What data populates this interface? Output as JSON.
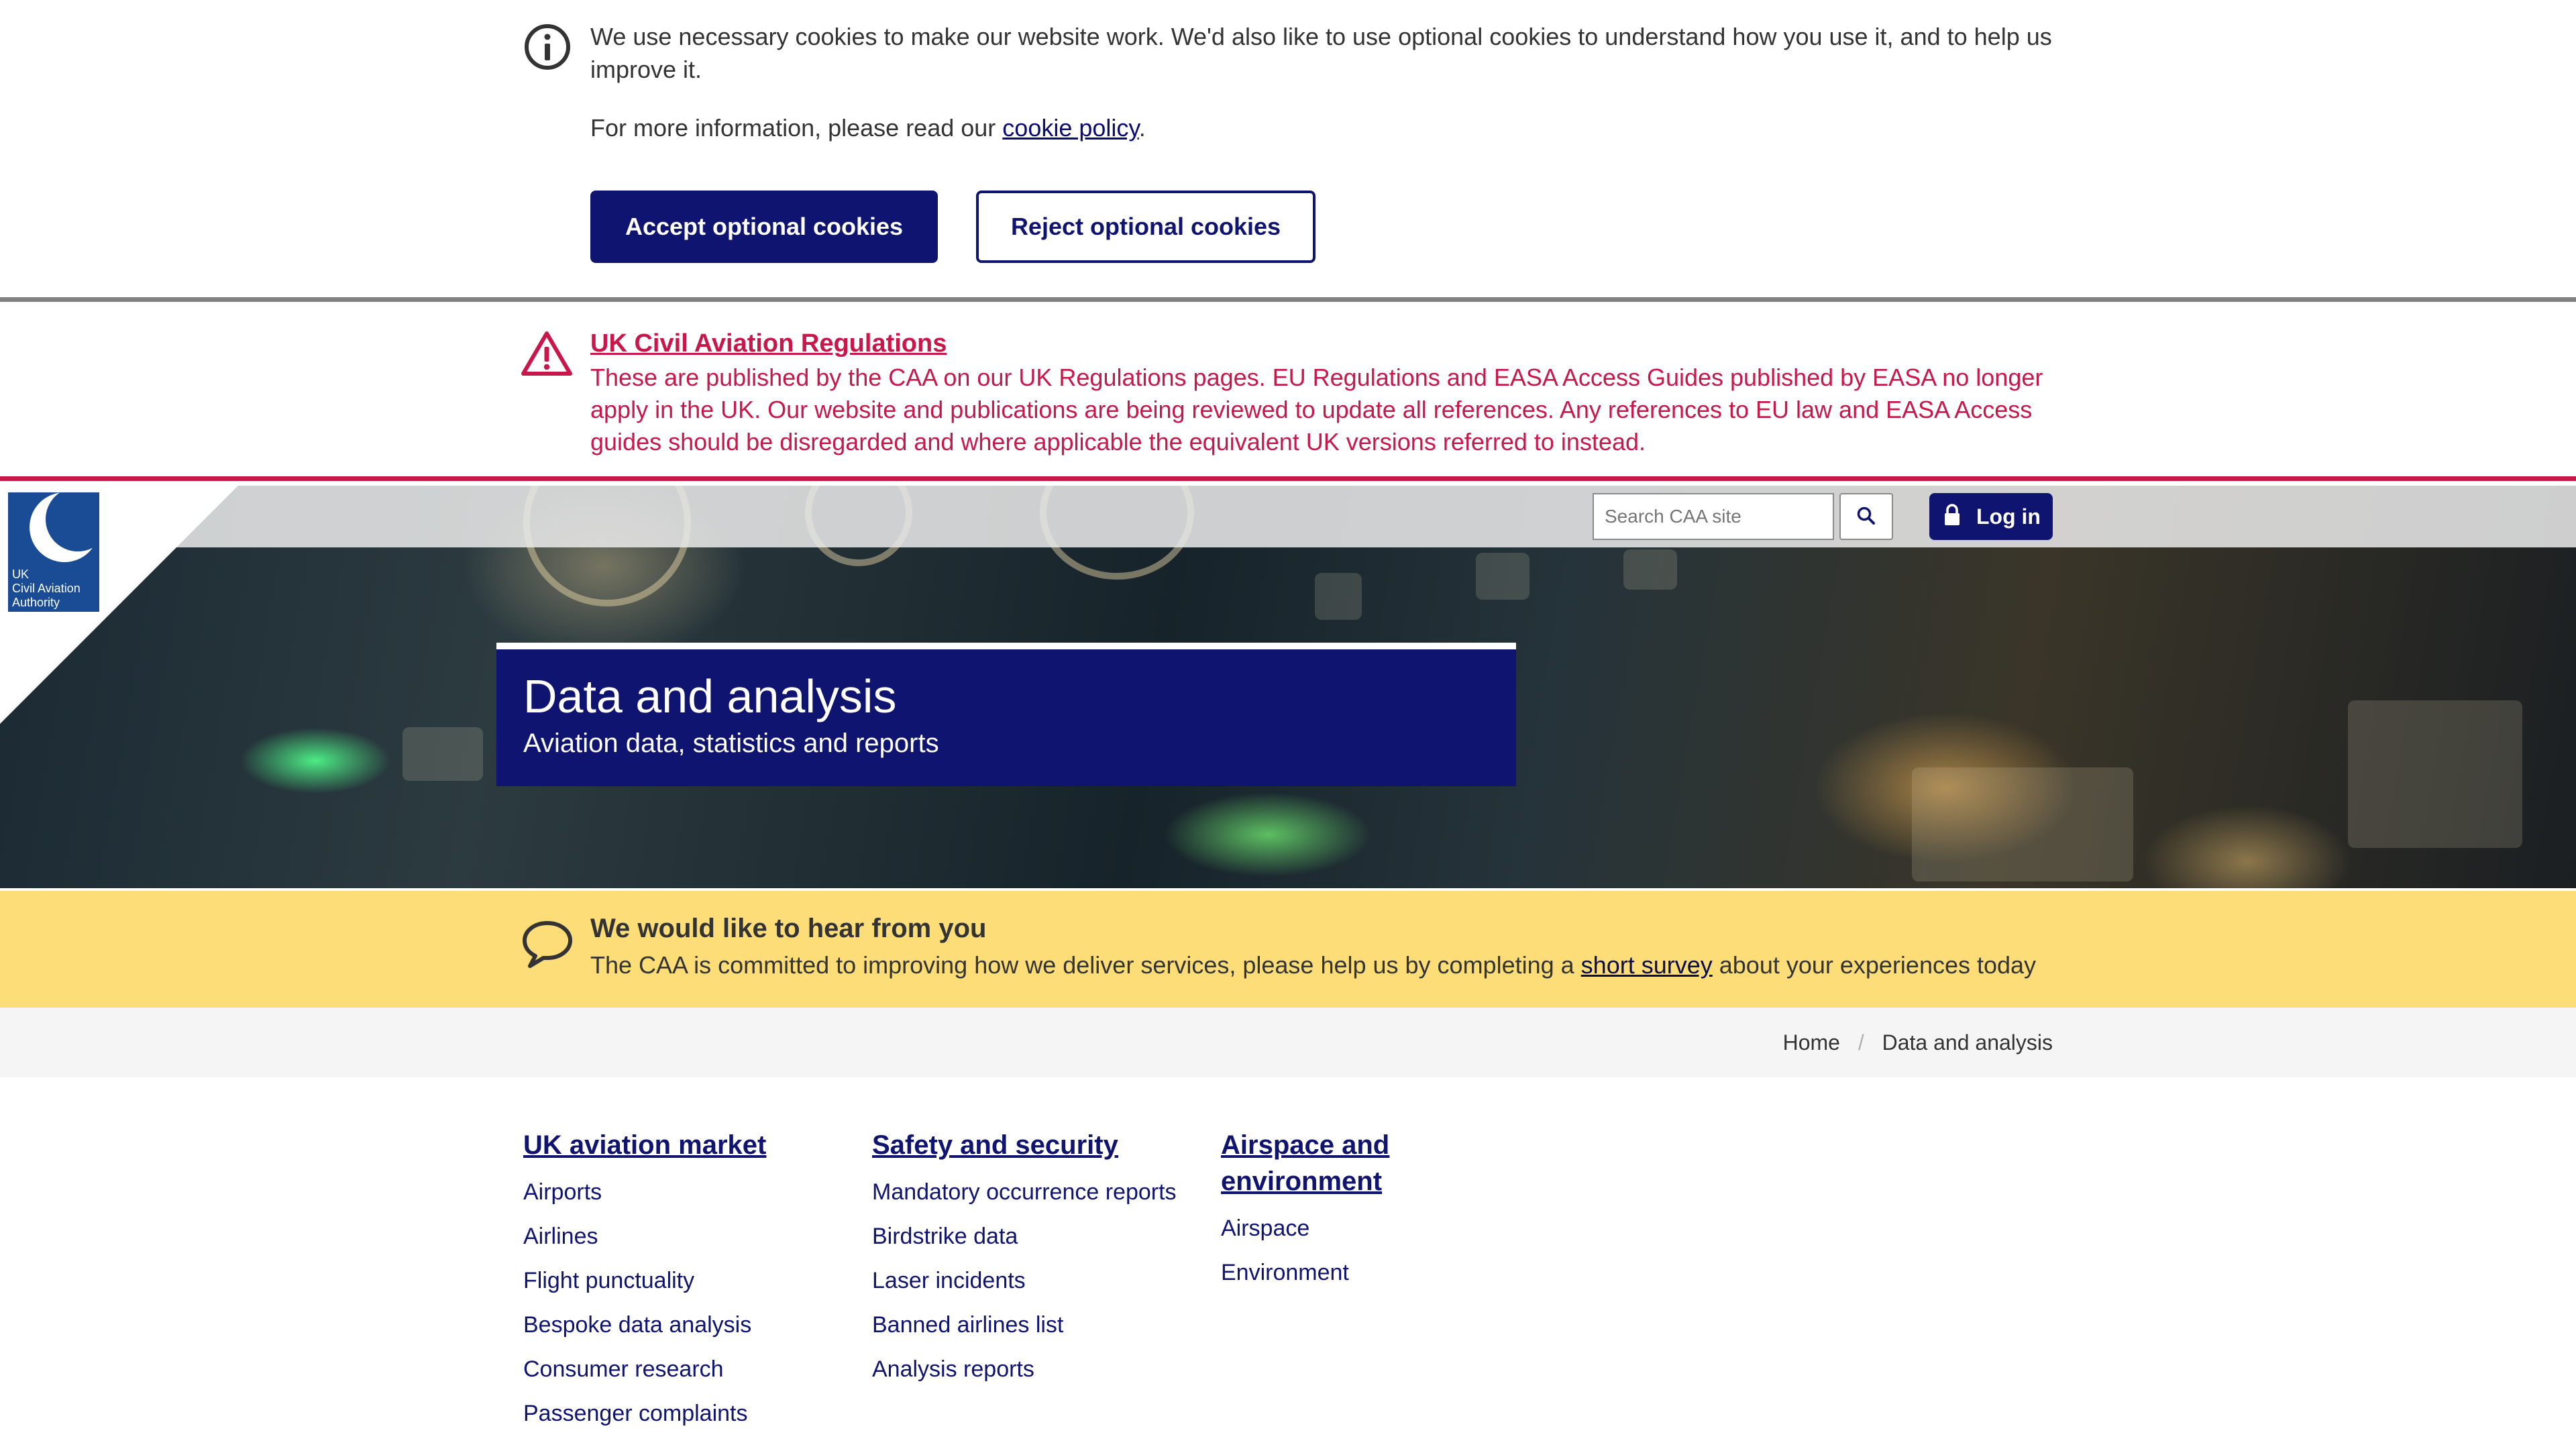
{
  "cookie_banner": {
    "message": "We use necessary cookies to make our website work. We'd also like to use optional cookies to understand how you use it, and to help us improve it.",
    "more_prefix": "For more information, please read our ",
    "policy_link": "cookie policy",
    "more_suffix": ".",
    "accept_label": "Accept optional cookies",
    "reject_label": "Reject optional cookies",
    "icon": "info-icon"
  },
  "regulations_notice": {
    "title": "UK Civil Aviation Regulations",
    "body": "These are published by the CAA on our UK Regulations pages. EU Regulations and EASA Access Guides published by EASA no longer apply in the UK. Our website and publications are being reviewed to update all references. Any references to EU law and EASA Access guides should be disregarded and where applicable the equivalent UK versions referred to instead.",
    "icon": "warning-icon"
  },
  "header": {
    "logo_text": [
      "UK",
      "Civil Aviation",
      "Authority"
    ],
    "search_placeholder": "Search CAA site",
    "login_label": "Log in"
  },
  "hero": {
    "title": "Data and analysis",
    "subtitle": "Aviation data, statistics and reports"
  },
  "survey": {
    "heading": "We would like to hear from you",
    "body_prefix": "The CAA is committed to improving how we deliver services, please help us by completing a ",
    "link": "short survey",
    "body_suffix": " about your experiences today"
  },
  "breadcrumb": {
    "home": "Home",
    "separator": "/",
    "current": "Data and analysis"
  },
  "columns": [
    {
      "heading": "UK aviation market",
      "links": [
        "Airports",
        "Airlines",
        "Flight punctuality",
        "Bespoke data analysis",
        "Consumer research",
        "Passenger complaints"
      ]
    },
    {
      "heading": "Safety and security",
      "links": [
        "Mandatory occurrence reports",
        "Birdstrike data",
        "Laser incidents",
        "Banned airlines list",
        "Analysis reports"
      ]
    },
    {
      "heading_line1": "Airspace and",
      "heading_line2": "environment",
      "links": [
        "Airspace",
        "Environment"
      ]
    }
  ],
  "colors": {
    "navy": "#0f1470",
    "alert_red": "#c8174a",
    "survey_yellow": "#fddd78"
  }
}
